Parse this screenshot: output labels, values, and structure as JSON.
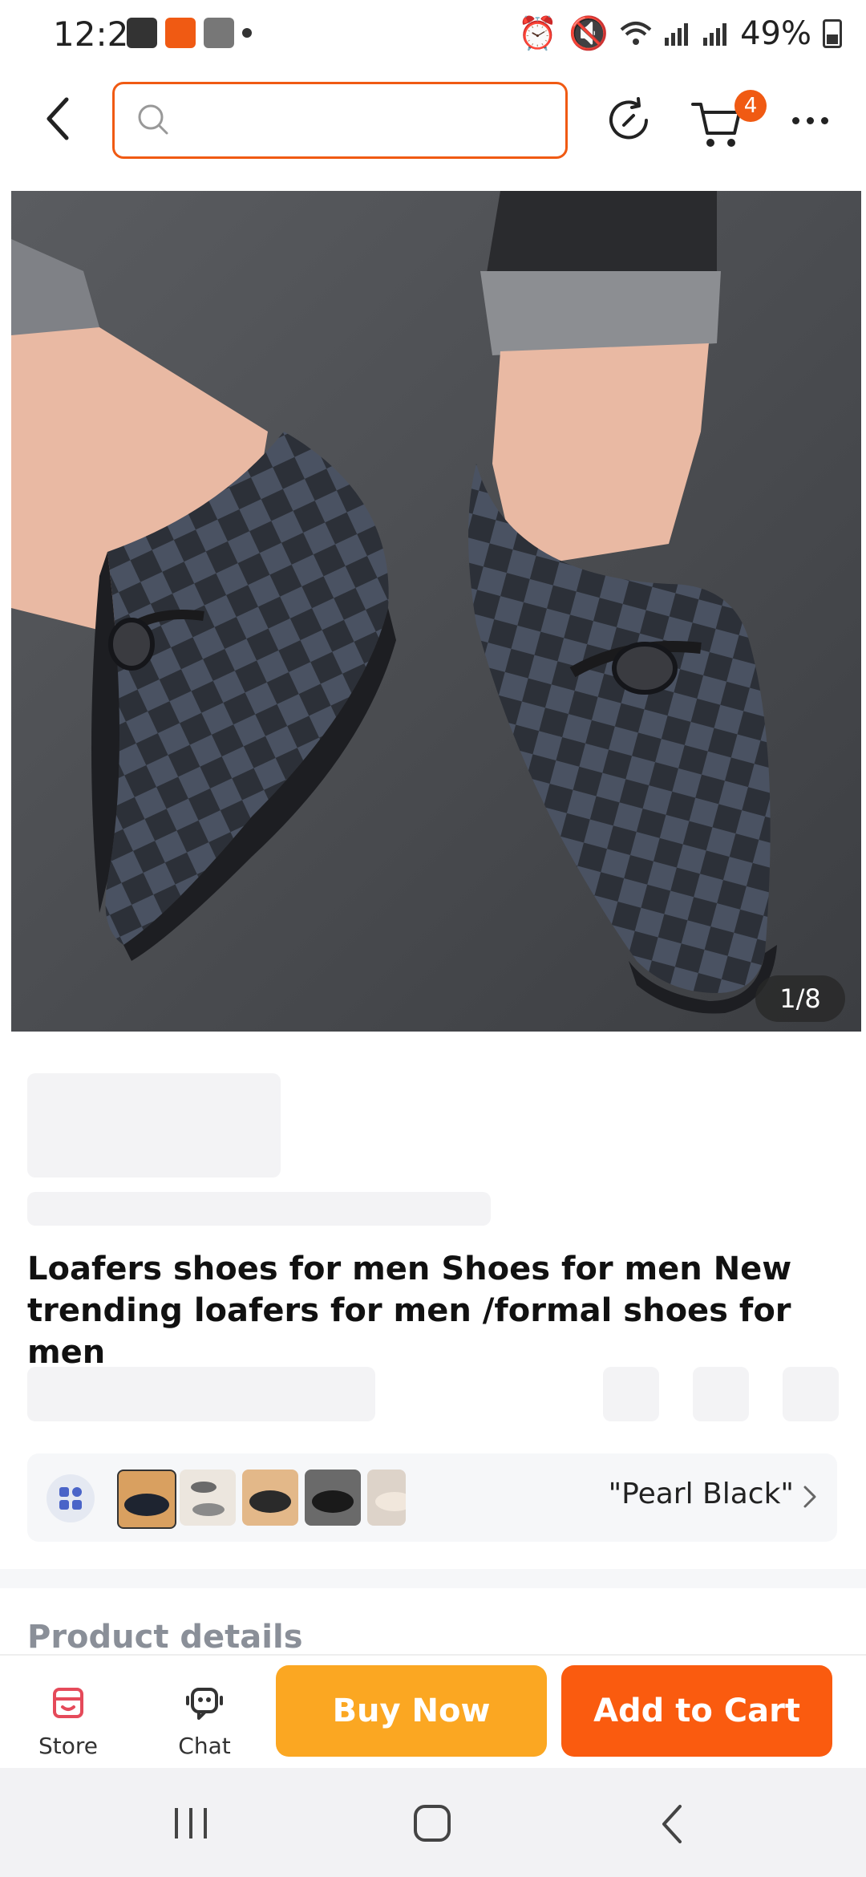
{
  "status_bar": {
    "time": "12:26",
    "battery": "49%"
  },
  "header": {
    "search_placeholder": "",
    "cart_count": "4",
    "icons": [
      "back-icon",
      "search-icon",
      "history-icon",
      "cart-icon",
      "more-icon"
    ]
  },
  "product": {
    "image_counter": "1/8",
    "title": "Loafers shoes  for men  Shoes for men  New trending loafers for men /formal shoes for men",
    "selected_variant": "\"Pearl Black\"",
    "section_title": "Product details"
  },
  "bottom_bar": {
    "store_label": "Store",
    "chat_label": "Chat",
    "buy_now_label": "Buy Now",
    "add_to_cart_label": "Add to Cart"
  },
  "colors": {
    "accent": "#f05a13",
    "buy_now": "#fba722",
    "add_to_cart": "#fa5b0f",
    "store_icon": "#e54a5a"
  }
}
